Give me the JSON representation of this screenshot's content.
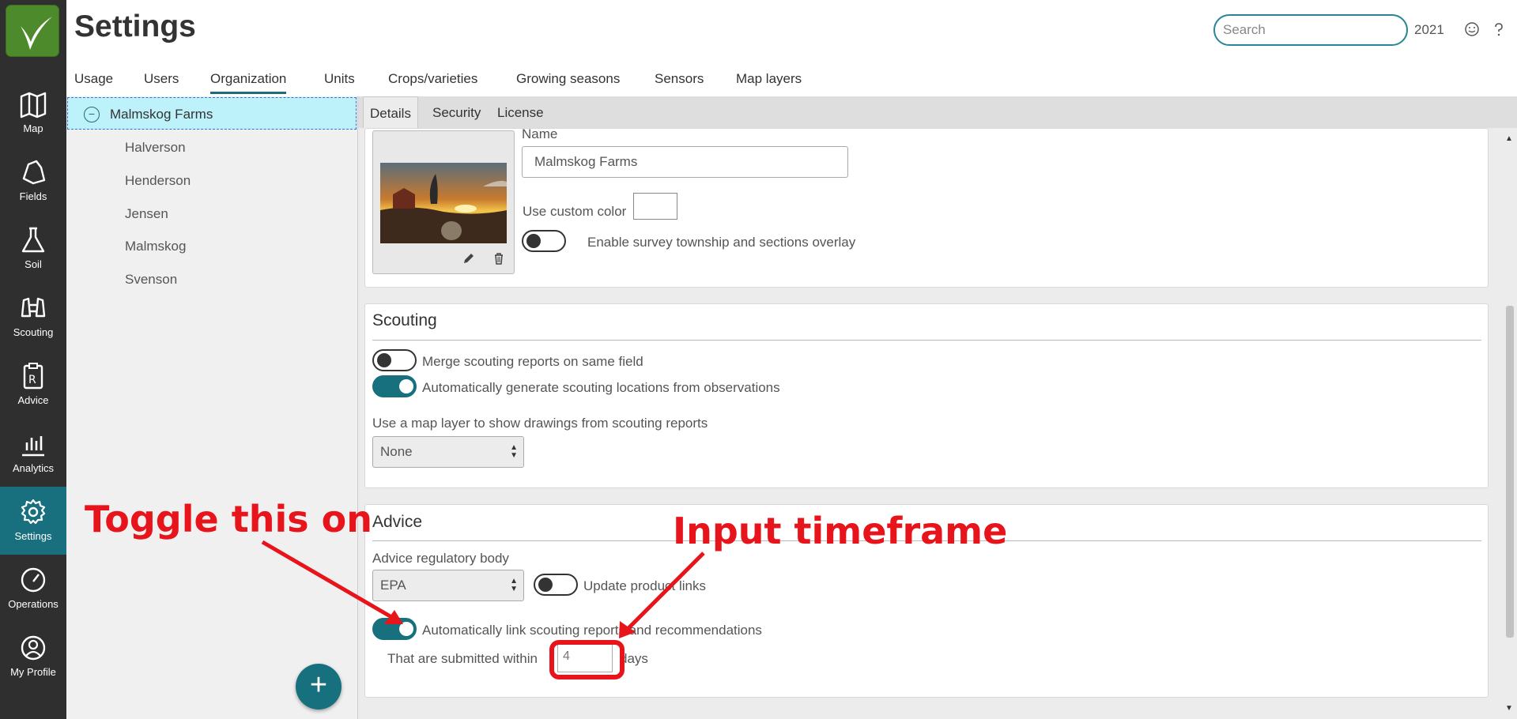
{
  "header": {
    "title": "Settings",
    "search_placeholder": "Search",
    "year": "2021"
  },
  "tabs": [
    {
      "label": "Usage",
      "active": false
    },
    {
      "label": "Users",
      "active": false
    },
    {
      "label": "Organization",
      "active": true
    },
    {
      "label": "Units",
      "active": false
    },
    {
      "label": "Crops/varieties",
      "active": false
    },
    {
      "label": "Growing seasons",
      "active": false
    },
    {
      "label": "Sensors",
      "active": false
    },
    {
      "label": "Map layers",
      "active": false
    }
  ],
  "nav": [
    {
      "label": "Map",
      "icon": "map-icon"
    },
    {
      "label": "Fields",
      "icon": "field-icon"
    },
    {
      "label": "Soil",
      "icon": "flask-icon"
    },
    {
      "label": "Scouting",
      "icon": "binoculars-icon"
    },
    {
      "label": "Advice",
      "icon": "prescription-icon"
    },
    {
      "label": "Analytics",
      "icon": "bar-chart-icon"
    },
    {
      "label": "Settings",
      "icon": "gear-icon",
      "active": true
    },
    {
      "label": "Operations",
      "icon": "gauge-icon"
    },
    {
      "label": "My Profile",
      "icon": "user-icon"
    }
  ],
  "tree": {
    "root": "Malmskog Farms",
    "children": [
      "Halverson",
      "Henderson",
      "Jensen",
      "Malmskog",
      "Svenson"
    ]
  },
  "subtabs": [
    {
      "label": "Details",
      "active": true
    },
    {
      "label": "Security",
      "active": false
    },
    {
      "label": "License",
      "active": false
    }
  ],
  "details": {
    "name_label": "Name",
    "name_value": "Malmskog Farms",
    "custom_color_label": "Use custom color",
    "survey_overlay_label": "Enable survey township and sections overlay",
    "survey_overlay_on": false
  },
  "scouting": {
    "title": "Scouting",
    "merge_label": "Merge scouting reports on same field",
    "merge_on": false,
    "auto_generate_label": "Automatically generate scouting locations from observations",
    "auto_generate_on": true,
    "map_layer_label": "Use a map layer to show drawings from scouting reports",
    "map_layer_value": "None"
  },
  "advice": {
    "title": "Advice",
    "regulatory_label": "Advice regulatory body",
    "regulatory_value": "EPA",
    "update_links_label": "Update product links",
    "update_links_on": false,
    "auto_link_label": "Automatically link scouting reports and recommendations",
    "auto_link_on": true,
    "submitted_within_label": "That are submitted within",
    "days_value": "4",
    "days_label": "days"
  },
  "annotations": {
    "toggle_note": "Toggle this on",
    "timeframe_note": "Input timeframe",
    "color": "#e8141c"
  },
  "colors": {
    "accent": "#17707e",
    "nav_bg": "#2f2f2f",
    "selected_tree": "#bdf2fb"
  }
}
